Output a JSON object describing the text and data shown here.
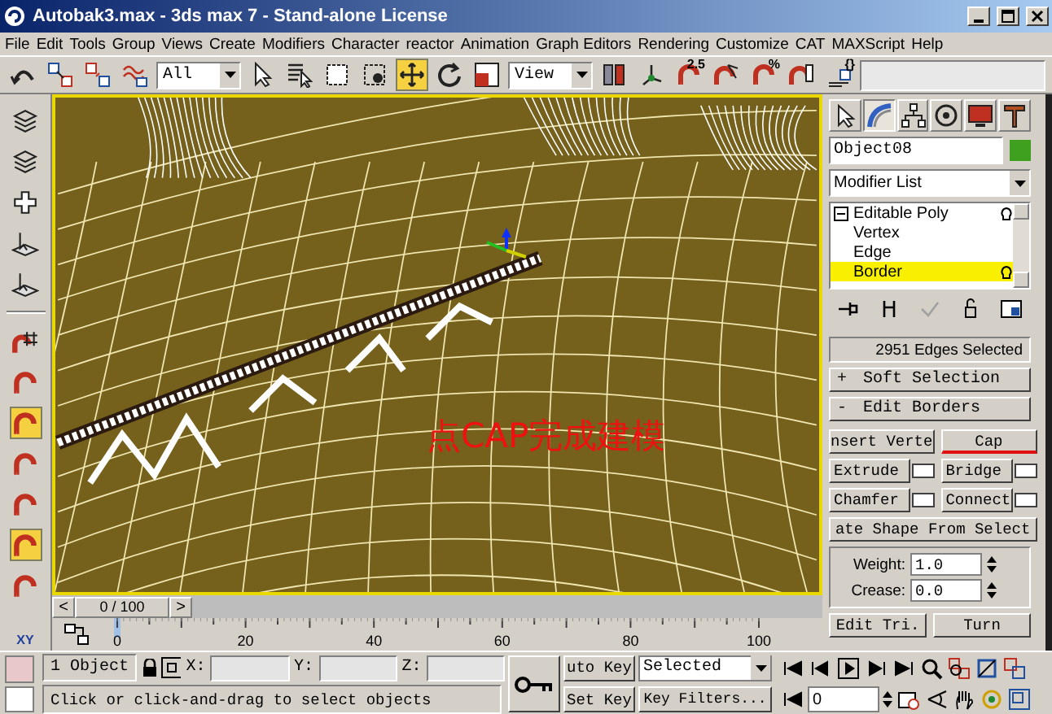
{
  "window": {
    "title": "Autobak3.max - 3ds max 7  - Stand-alone License"
  },
  "menu": [
    "File",
    "Edit",
    "Tools",
    "Group",
    "Views",
    "Create",
    "Modifiers",
    "Character",
    "reactor",
    "Animation",
    "Graph Editors",
    "Rendering",
    "Customize",
    "CAT",
    "MAXScript",
    "Help"
  ],
  "toolbar": [
    {
      "kind": "undo",
      "selected": false
    },
    {
      "kind": "link",
      "selected": false
    },
    {
      "kind": "unlink",
      "selected": false
    },
    {
      "kind": "bind",
      "selected": false
    },
    {
      "kind": "dropdown",
      "value": "All"
    },
    {
      "kind": "select",
      "selected": false
    },
    {
      "kind": "select-name",
      "selected": false
    },
    {
      "kind": "region",
      "selected": false
    },
    {
      "kind": "crossing",
      "selected": false
    },
    {
      "kind": "move",
      "selected": true
    },
    {
      "kind": "rotate",
      "selected": false
    },
    {
      "kind": "scale",
      "selected": false
    },
    {
      "kind": "dropdown",
      "value": "View"
    },
    {
      "kind": "pivot",
      "selected": false
    },
    {
      "kind": "axis",
      "selected": false
    },
    {
      "kind": "snap",
      "label": "2.5",
      "selected": false
    },
    {
      "kind": "angle-snap",
      "selected": false
    },
    {
      "kind": "snap",
      "label": "%",
      "selected": false
    },
    {
      "kind": "spinner-snap",
      "selected": false
    },
    {
      "kind": "named-sel",
      "label": "{}",
      "selected": false
    },
    {
      "kind": "field"
    }
  ],
  "left_tools": [
    {
      "kind": "layers",
      "selected": false
    },
    {
      "kind": "layers",
      "selected": false
    },
    {
      "kind": "plus",
      "selected": false
    },
    {
      "kind": "plane",
      "selected": false
    },
    {
      "kind": "plane",
      "selected": false
    },
    {
      "kind": "magnet-grid",
      "selected": false
    },
    {
      "kind": "magnet",
      "selected": false
    },
    {
      "kind": "magnet",
      "selected": true
    },
    {
      "kind": "magnet",
      "selected": false
    },
    {
      "kind": "magnet",
      "selected": false
    },
    {
      "kind": "magnet",
      "selected": true
    },
    {
      "kind": "magnet",
      "selected": false
    }
  ],
  "axis_label": "XY",
  "viewport": {
    "annotation": "点CAP完成建模"
  },
  "time_slider": {
    "thumb": "0 / 100",
    "prev": "<",
    "next": ">"
  },
  "track_labels": [
    "0",
    "20",
    "40",
    "60",
    "80",
    "100"
  ],
  "command_panel": {
    "tabs": [
      {
        "kind": "create",
        "selected": false
      },
      {
        "kind": "modify",
        "selected": true
      },
      {
        "kind": "hierarchy",
        "selected": false
      },
      {
        "kind": "motion",
        "selected": false
      },
      {
        "kind": "display",
        "selected": false
      },
      {
        "kind": "utilities",
        "selected": false
      }
    ],
    "object_name": "Object08",
    "modifier_list": "Modifier List",
    "stack": [
      {
        "label": "Editable Poly",
        "selected": false,
        "expanded": true,
        "children": [
          {
            "label": "Vertex",
            "selected": false
          },
          {
            "label": "Edge",
            "selected": false
          },
          {
            "label": "Border",
            "selected": true
          }
        ]
      }
    ],
    "selection_info": "2951 Edges Selected",
    "rollouts": [
      {
        "sign": "+",
        "title": "Soft Selection"
      },
      {
        "sign": "-",
        "title": "Edit Borders",
        "buttons": [
          {
            "label": "nsert Verte",
            "settings": false,
            "underlined": false
          },
          {
            "label": "Cap",
            "settings": false,
            "underlined": true
          },
          {
            "label": "Extrude",
            "settings": true,
            "underlined": false
          },
          {
            "label": "Bridge",
            "settings": true,
            "underlined": false
          },
          {
            "label": "Chamfer",
            "settings": true,
            "underlined": false
          },
          {
            "label": "Connect",
            "settings": true,
            "underlined": false
          },
          {
            "label": "ate Shape From Select",
            "settings": false,
            "underlined": false
          }
        ],
        "spinners": [
          {
            "label": "Weight:",
            "value": "1.0"
          },
          {
            "label": "Crease:",
            "value": "0.0"
          }
        ],
        "footer_buttons": [
          "Edit Tri.",
          "Turn"
        ]
      }
    ]
  },
  "status": {
    "selection": "1 Object",
    "coords": [
      "X:",
      "Y:",
      "Z:"
    ],
    "auto_key": "uto Key",
    "key_mode": "Selected",
    "set_key": "Set Key",
    "key_filters": "Key Filters...",
    "frame": "0",
    "prompt": "Click or click-and-drag to select objects"
  }
}
